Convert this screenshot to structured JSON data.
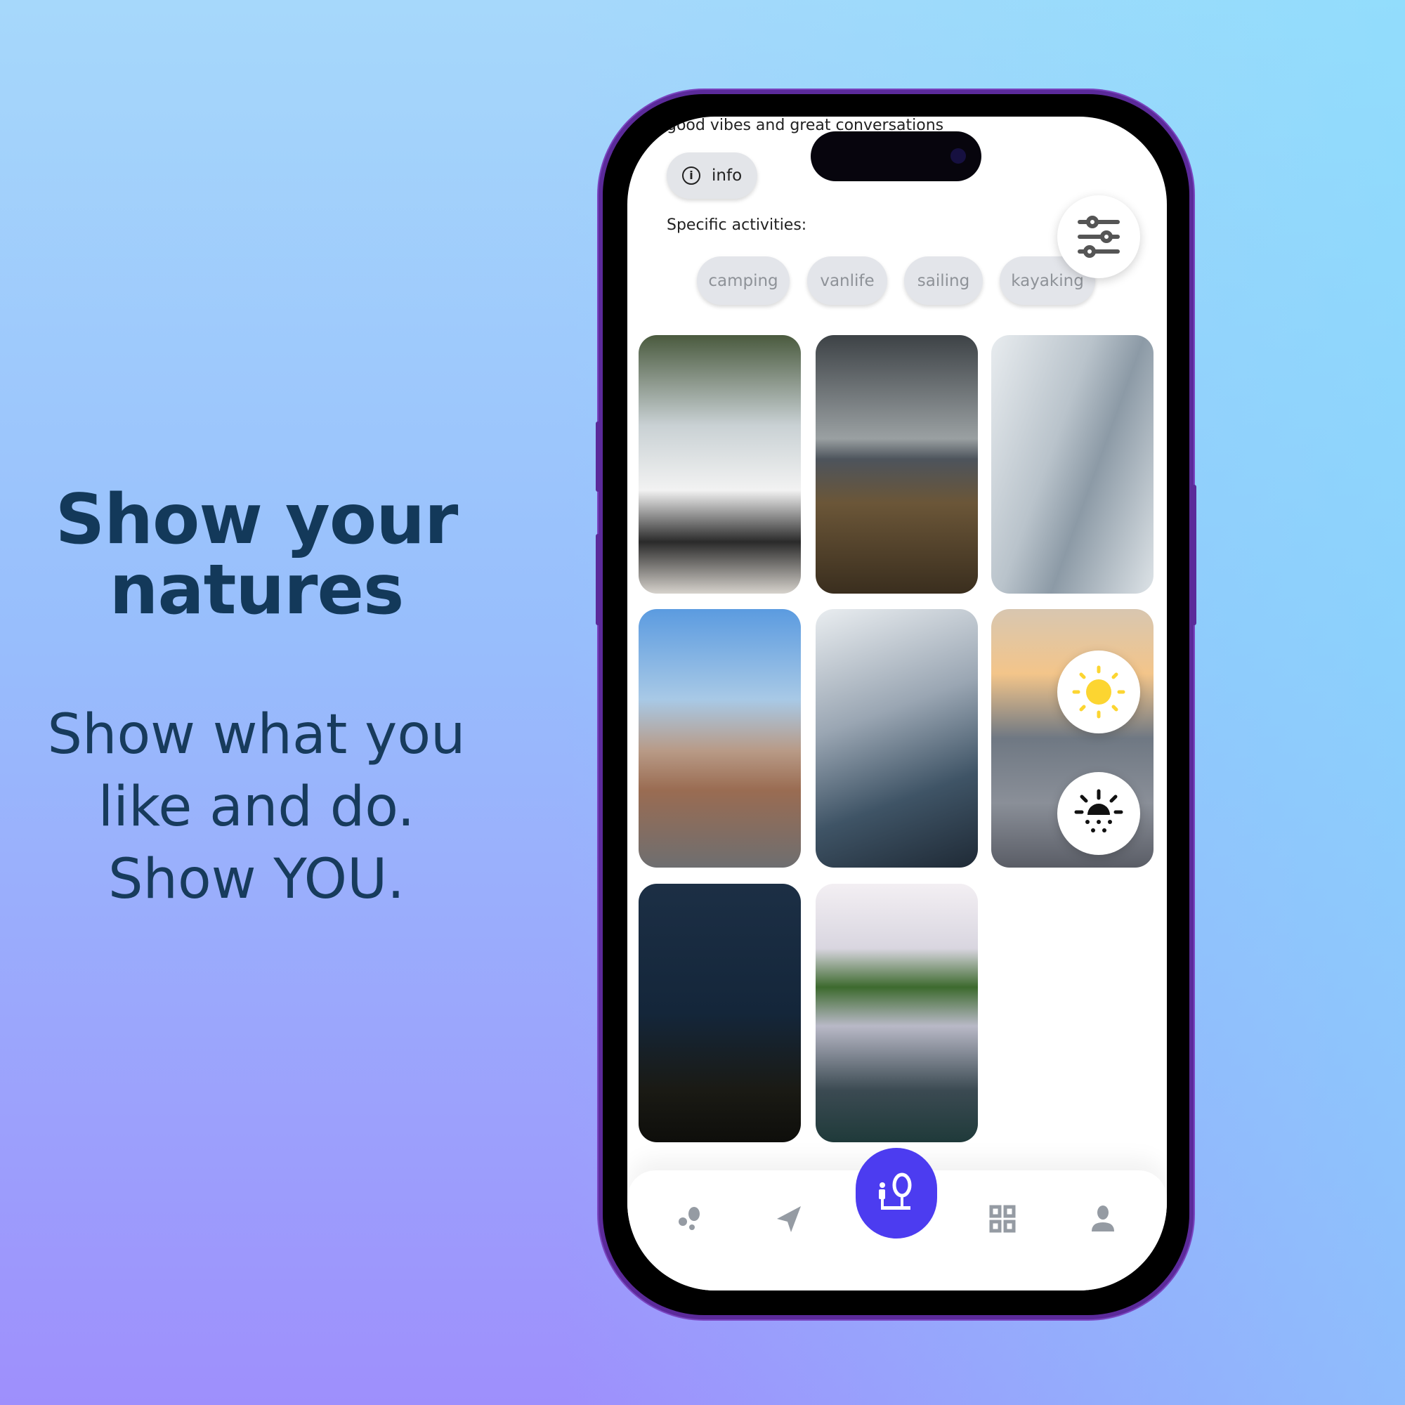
{
  "promo": {
    "headline_line1": "Show your",
    "headline_line2": "natures",
    "sub_line1": "Show what you",
    "sub_line2": "like and do.",
    "sub_line3": "Show YOU."
  },
  "app": {
    "tagline": "good vibes and great conversations",
    "info_label": "info",
    "activities_label": "Specific activities:",
    "chips": [
      {
        "label": "camping"
      },
      {
        "label": "vanlife"
      },
      {
        "label": "sailing"
      },
      {
        "label": "kayaking"
      }
    ],
    "photos": [
      "white van in snowy forest",
      "orange tent under cloudy sky",
      "sailboat deck on sea",
      "van parked at canyon overlook",
      "sail over sunset sea",
      "sailboat wake at sunset",
      "lit tent at night under stars",
      "kayak bow on calm lake"
    ],
    "fabs": {
      "filter": "sliders-icon",
      "light_mode": "sun-icon",
      "dark_mode": "sunset-icon"
    },
    "nav": [
      "bubbles-icon",
      "navigation-arrow-icon",
      "person-mirror-icon",
      "grid-icon",
      "user-icon"
    ],
    "colors": {
      "accent": "#4c3cf0",
      "nav_icon": "#959ba3",
      "sun": "#fcd531",
      "frame": "#5b2a9a",
      "headline": "#13395a"
    }
  }
}
